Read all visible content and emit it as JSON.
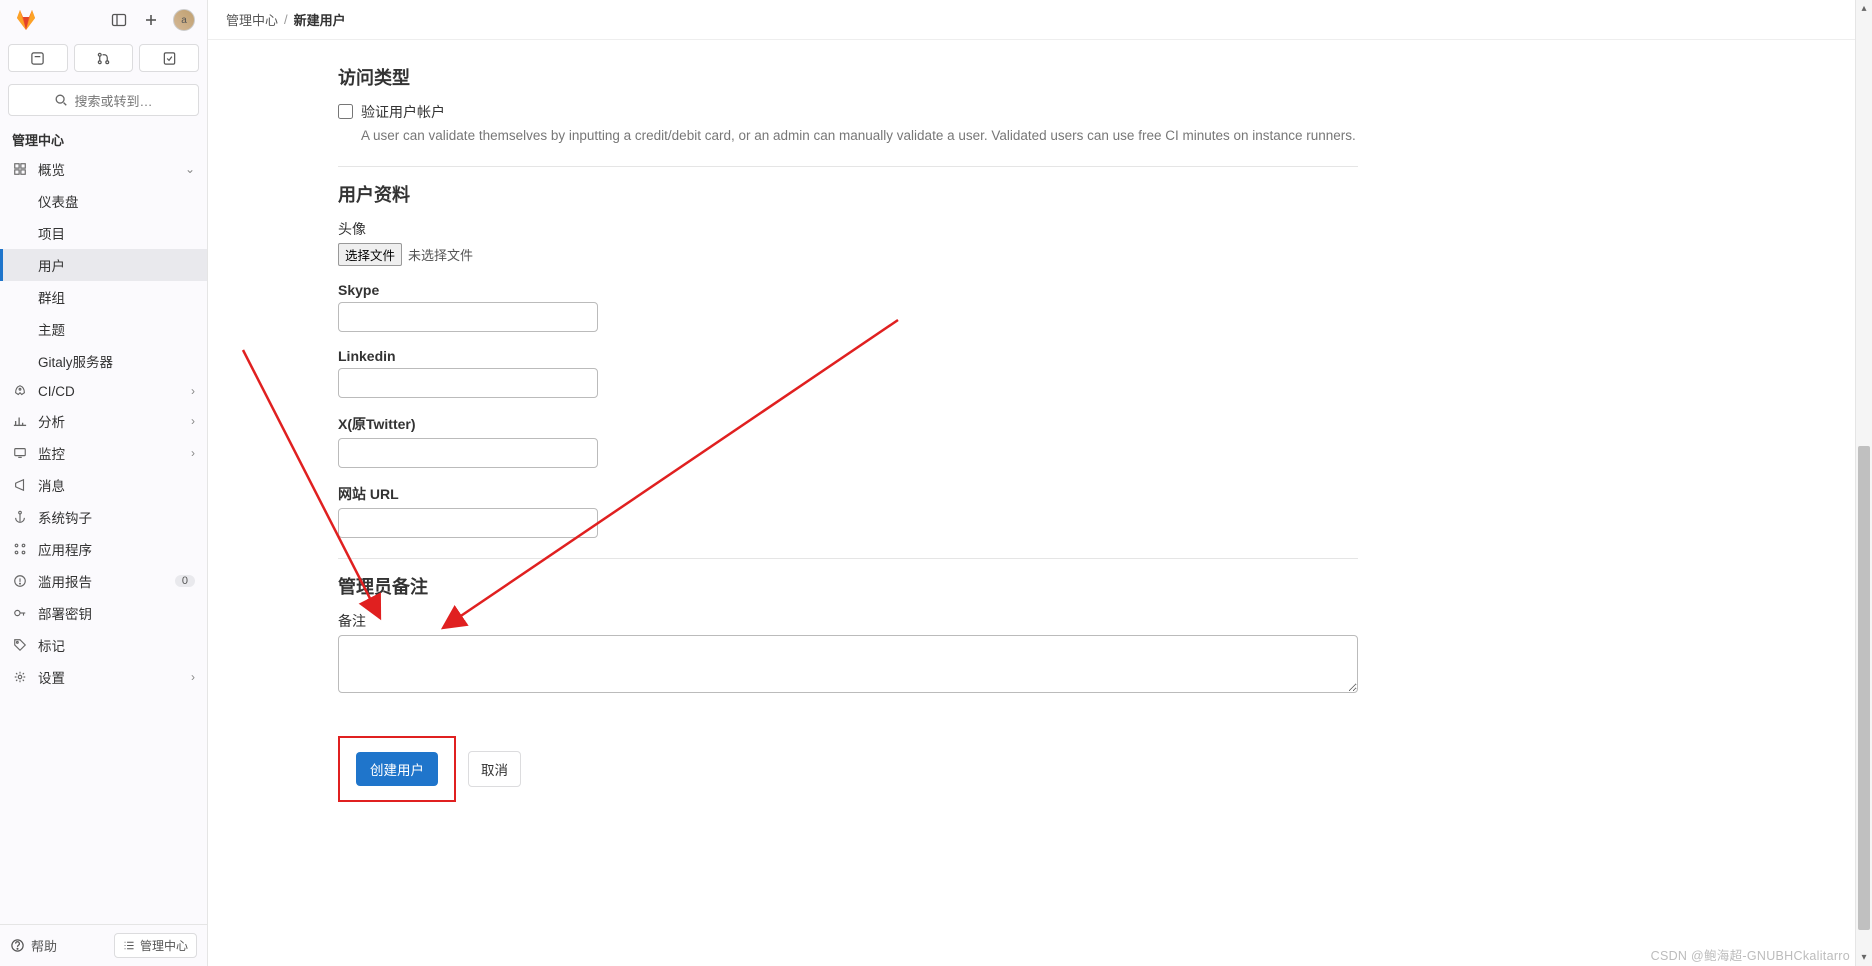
{
  "topbar": {
    "search_placeholder": "搜索或转到…"
  },
  "breadcrumb": {
    "root": "管理中心",
    "current": "新建用户"
  },
  "sidebar": {
    "title": "管理中心",
    "overview": {
      "label": "概览"
    },
    "overview_sub": {
      "dashboard": "仪表盘",
      "projects": "项目",
      "users": "用户",
      "groups": "群组",
      "topics": "主题",
      "gitaly": "Gitaly服务器"
    },
    "items": {
      "cicd": "CI/CD",
      "analytics": "分析",
      "monitoring": "监控",
      "messages": "消息",
      "hooks": "系统钩子",
      "applications": "应用程序",
      "abuse": "滥用报告",
      "deploy_keys": "部署密钥",
      "labels": "标记",
      "settings": "设置"
    },
    "abuse_badge": "0",
    "footer": {
      "help": "帮助",
      "admin": "管理中心"
    }
  },
  "form": {
    "access_section": {
      "title": "访问类型",
      "validate_label": "验证用户帐户",
      "validate_desc": "A user can validate themselves by inputting a credit/debit card, or an admin can manually validate a user. Validated users can use free CI minutes on instance runners."
    },
    "profile_section": {
      "title": "用户资料",
      "avatar_label": "头像",
      "choose_file": "选择文件",
      "no_file": "未选择文件",
      "skype": "Skype",
      "linkedin": "Linkedin",
      "twitter": "X(原Twitter)",
      "website": "网站 URL"
    },
    "notes_section": {
      "title": "管理员备注",
      "notes_label": "备注"
    },
    "actions": {
      "create": "创建用户",
      "cancel": "取消"
    }
  },
  "watermark": "CSDN @鲍海超-GNUBHCkalitarro"
}
